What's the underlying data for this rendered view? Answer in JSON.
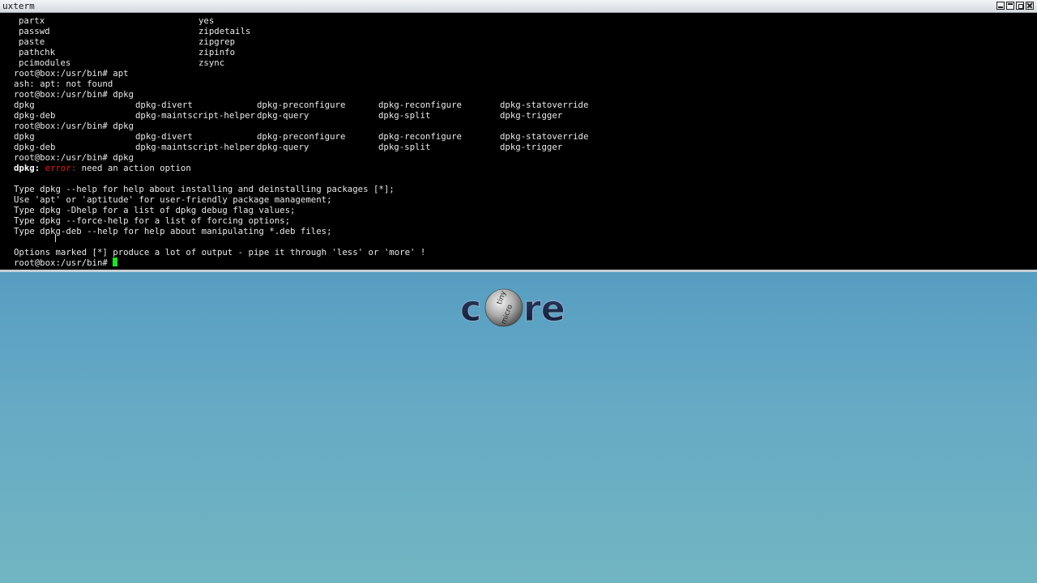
{
  "window": {
    "title": "uxterm"
  },
  "terminal": {
    "list1": [
      [
        "partx",
        "yes"
      ],
      [
        "passwd",
        "zipdetails"
      ],
      [
        "paste",
        "zipgrep"
      ],
      [
        "pathchk",
        "zipinfo"
      ],
      [
        "pcimodules",
        "zsync"
      ]
    ],
    "cmd_apt": "root@box:/usr/bin# apt",
    "apt_error": "ash: apt: not found",
    "cmd_dpkg1": "root@box:/usr/bin# dpkg",
    "completions1_row1": [
      "dpkg",
      "dpkg-divert",
      "dpkg-preconfigure",
      "dpkg-reconfigure",
      "dpkg-statoverride"
    ],
    "completions1_row2": [
      "dpkg-deb",
      "dpkg-maintscript-helper",
      "dpkg-query",
      "dpkg-split",
      "dpkg-trigger"
    ],
    "cmd_dpkg2": "root@box:/usr/bin# dpkg",
    "completions2_row1": [
      "dpkg",
      "dpkg-divert",
      "dpkg-preconfigure",
      "dpkg-reconfigure",
      "dpkg-statoverride"
    ],
    "completions2_row2": [
      "dpkg-deb",
      "dpkg-maintscript-helper",
      "dpkg-query",
      "dpkg-split",
      "dpkg-trigger"
    ],
    "cmd_dpkg3": "root@box:/usr/bin# dpkg",
    "error_prefix": "dpkg:",
    "error_word": "error:",
    "error_msg": " need an action option",
    "help1": "Type dpkg --help for help about installing and deinstalling packages [*];",
    "help2": "Use 'apt' or 'aptitude' for user-friendly package management;",
    "help3": "Type dpkg -Dhelp for a list of dpkg debug flag values;",
    "help4": "Type dpkg --force-help for a list of forcing options;",
    "help5": "Type dpkg-deb --help for help about manipulating *.deb files;",
    "options_note": "Options marked [*] produce a lot of output - pipe it through 'less' or 'more' !",
    "prompt": "root@box:/usr/bin# "
  },
  "desktop": {
    "logo_text": "core",
    "logo_ball_text_top": "tiny",
    "logo_ball_text_bottom": "micro"
  },
  "colors": {
    "cursor": "#22e02a",
    "error": "#e02020",
    "desktop_top": "#3d87b6",
    "desktop_bottom": "#72b5c2"
  }
}
